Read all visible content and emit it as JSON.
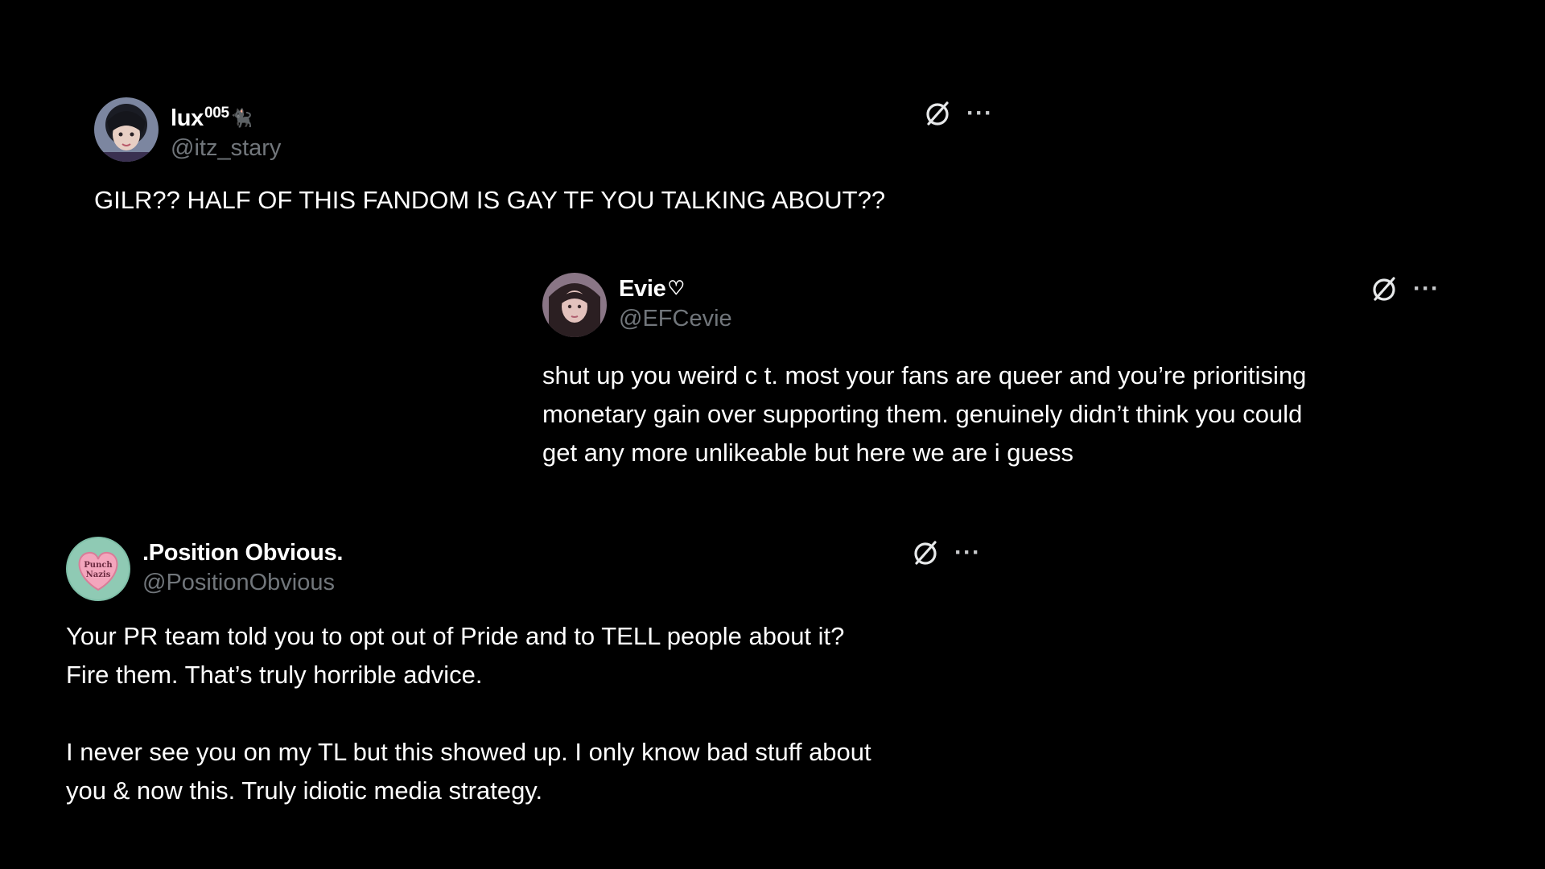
{
  "tweets": [
    {
      "display_name": "lux",
      "display_name_sup": "005",
      "display_name_deco": "🐈‍⬛",
      "handle": "@itz_stary",
      "text": "GILR?? HALF OF THIS FANDOM IS GAY TF YOU TALKING ABOUT??",
      "avatar_icon": "user-avatar-icon",
      "action_icon": "grok-slash-icon",
      "more_icon": "more-dots-icon",
      "more_label": "···"
    },
    {
      "display_name": "Evie",
      "display_name_deco": "♡",
      "handle": "@EFCevie",
      "text": "shut up you weird c      t. most your fans are queer and you’re prioritising\nmonetary gain over supporting them. genuinely didn’t think you could\nget any more unlikeable but here we are i guess",
      "avatar_icon": "user-avatar-icon",
      "action_icon": "grok-slash-icon",
      "more_icon": "more-dots-icon",
      "more_label": "···"
    },
    {
      "display_name": ".Position Obvious.",
      "handle": "@PositionObvious",
      "avatar_badge": "Punch Nazis",
      "text": "Your PR team told you to opt out of Pride and to TELL people about it?\nFire them. That’s truly horrible advice.\n\nI never see you on my TL but this showed up. I only know bad stuff about\nyou & now this. Truly idiotic media strategy.",
      "avatar_icon": "heart-badge-avatar-icon",
      "action_icon": "grok-slash-icon",
      "more_icon": "more-dots-icon",
      "more_label": "···"
    }
  ],
  "colors": {
    "background": "#000000",
    "text": "#ffffff",
    "handle": "#71767b",
    "avatar3_bg": "#7fbfa8",
    "avatar3_heart": "#f3a6bd"
  }
}
